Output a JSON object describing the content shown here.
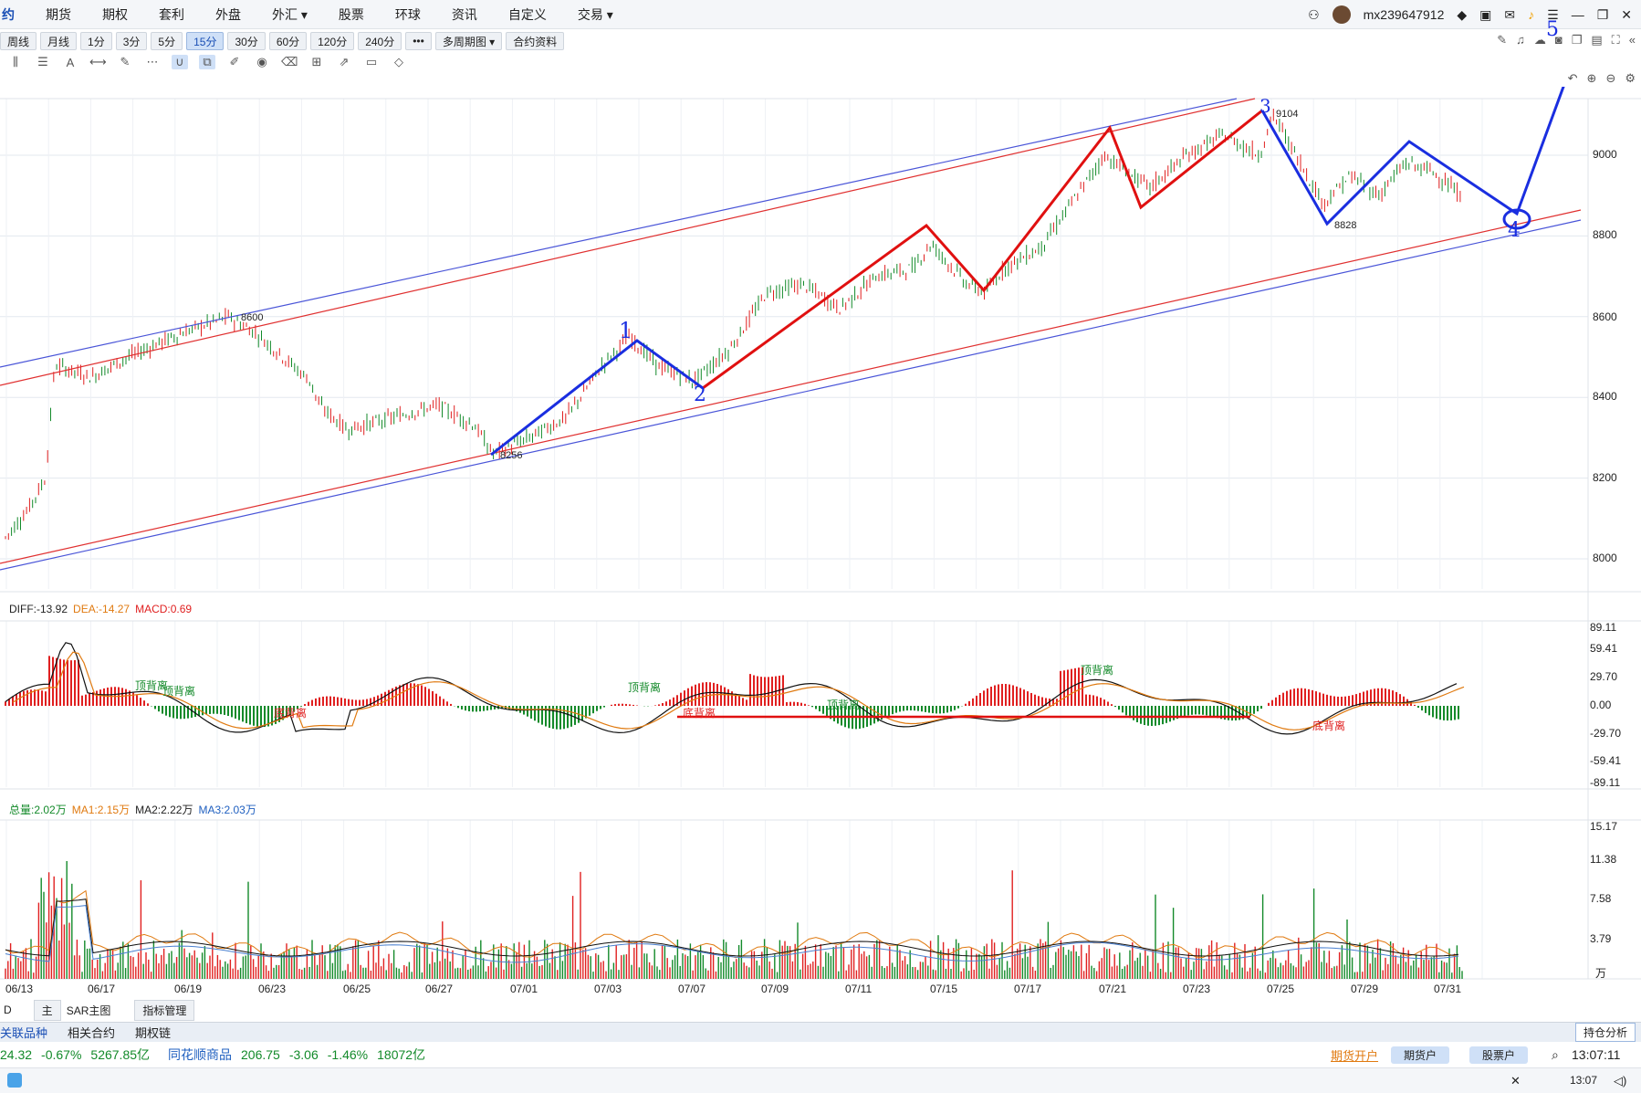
{
  "menubar": {
    "items": [
      "约",
      "期货",
      "期权",
      "套利",
      "外盘",
      "外汇 ▾",
      "股票",
      "环球",
      "资讯",
      "自定义",
      "交易 ▾"
    ],
    "username": "mx239647912"
  },
  "periods": [
    "周线",
    "月线",
    "1分",
    "3分",
    "5分",
    "15分",
    "30分",
    "60分",
    "120分",
    "240分",
    "•••",
    "多周期图 ▾",
    "合约资料"
  ],
  "selected_period": "15分",
  "price_axis": [
    "9000",
    "8800",
    "8600",
    "8400",
    "8200",
    "8000"
  ],
  "macd": {
    "diff": "DIFF:-13.92",
    "dea": "DEA:-14.27",
    "macd": "MACD:0.69",
    "axis": [
      "89.11",
      "59.41",
      "29.70",
      "0.00",
      "-29.70",
      "-59.41",
      "-89.11"
    ],
    "annotations": [
      "顶背离",
      "顶背离",
      "底背离",
      "顶背离",
      "底背离",
      "顶背离",
      "顶背离",
      "底背离"
    ]
  },
  "volume": {
    "total": "总量:2.02万",
    "ma1": "MA1:2.15万",
    "ma2": "MA2:2.22万",
    "ma3": "MA3:2.03万",
    "axis": [
      "15.17",
      "11.38",
      "7.58",
      "3.79",
      "万"
    ]
  },
  "dates": [
    "06/13",
    "06/17",
    "06/19",
    "06/23",
    "06/25",
    "06/27",
    "07/01",
    "07/03",
    "07/07",
    "07/09",
    "07/11",
    "07/15",
    "07/17",
    "07/21",
    "07/23",
    "07/25",
    "07/29",
    "07/31"
  ],
  "price_marks": {
    "high1": "8600",
    "low1": "8256",
    "high2": "9104",
    "low2": "8828"
  },
  "handwritten": [
    "1",
    "2",
    "3",
    "4",
    "5"
  ],
  "bottom_tabs": [
    "D",
    "主",
    "SAR主图",
    "指标管理"
  ],
  "related": {
    "items": [
      "关联品种",
      "相关合约",
      "期权链"
    ],
    "button": "持仓分析"
  },
  "ticker": {
    "value": "24.32",
    "change_pct": "-0.67%",
    "turnover": "5267.85亿",
    "index_name": "同花顺商品",
    "index_value": "206.75",
    "index_change": "-3.06",
    "index_pct": "-1.46%",
    "index_turnover": "18072亿"
  },
  "status_bar": {
    "link": "期货开户",
    "btn1": "期货户",
    "btn2": "股票户",
    "time": "13:07:11",
    "clock": "13:07"
  },
  "colors": {
    "up": "#e02020",
    "down": "#138a2a",
    "diff": "#111111",
    "dea": "#e07a10",
    "annotation_blue": "#1a2ee0",
    "annotation_red": "#e01010"
  }
}
